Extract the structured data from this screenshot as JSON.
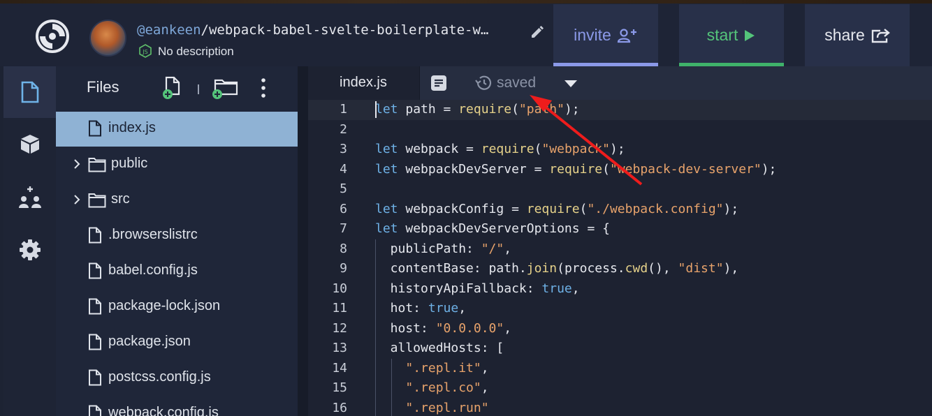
{
  "header": {
    "repo_user": "@eankeen",
    "repo_sep": "/",
    "repo_name": "webpack-babel-svelte-boilerplate-w…",
    "description": "No description",
    "invite_label": "invite",
    "start_label": "start",
    "share_label": "share",
    "colors": {
      "invite": "#8b99e8",
      "start": "#3fb26a"
    }
  },
  "icon_rail": [
    "files-icon",
    "packages-icon",
    "multiplayer-icon",
    "settings-icon"
  ],
  "files": {
    "title": "Files",
    "items": [
      {
        "name": "index.js",
        "type": "file",
        "active": true
      },
      {
        "name": "public",
        "type": "folder"
      },
      {
        "name": "src",
        "type": "folder"
      },
      {
        "name": ".browserslistrc",
        "type": "file"
      },
      {
        "name": "babel.config.js",
        "type": "file"
      },
      {
        "name": "package-lock.json",
        "type": "file"
      },
      {
        "name": "package.json",
        "type": "file"
      },
      {
        "name": "postcss.config.js",
        "type": "file"
      },
      {
        "name": "webpack.config.js",
        "type": "file"
      }
    ]
  },
  "editor": {
    "tab": "index.js",
    "status": "saved",
    "lines": [
      [
        [
          "kw",
          "let"
        ],
        [
          "t",
          " path = "
        ],
        [
          "fn",
          "require"
        ],
        [
          "t",
          "("
        ],
        [
          "str",
          "\"path\""
        ],
        [
          "t",
          ");"
        ]
      ],
      [],
      [
        [
          "kw",
          "let"
        ],
        [
          "t",
          " webpack = "
        ],
        [
          "fn",
          "require"
        ],
        [
          "t",
          "("
        ],
        [
          "str",
          "\"webpack\""
        ],
        [
          "t",
          ");"
        ]
      ],
      [
        [
          "kw",
          "let"
        ],
        [
          "t",
          " webpackDevServer = "
        ],
        [
          "fn",
          "require"
        ],
        [
          "t",
          "("
        ],
        [
          "str",
          "\"webpack-dev-server\""
        ],
        [
          "t",
          ");"
        ]
      ],
      [],
      [
        [
          "kw",
          "let"
        ],
        [
          "t",
          " webpackConfig = "
        ],
        [
          "fn",
          "require"
        ],
        [
          "t",
          "("
        ],
        [
          "str",
          "\"./webpack.config\""
        ],
        [
          "t",
          ");"
        ]
      ],
      [
        [
          "kw",
          "let"
        ],
        [
          "t",
          " webpackDevServerOptions = {"
        ]
      ],
      [
        [
          "t",
          "  publicPath: "
        ],
        [
          "str",
          "\"/\""
        ],
        [
          "t",
          ","
        ]
      ],
      [
        [
          "t",
          "  contentBase: path."
        ],
        [
          "fn",
          "join"
        ],
        [
          "t",
          "(process."
        ],
        [
          "fn",
          "cwd"
        ],
        [
          "t",
          "(), "
        ],
        [
          "str",
          "\"dist\""
        ],
        [
          "t",
          "),"
        ]
      ],
      [
        [
          "t",
          "  historyApiFallback: "
        ],
        [
          "kw",
          "true"
        ],
        [
          "t",
          ","
        ]
      ],
      [
        [
          "t",
          "  hot: "
        ],
        [
          "kw",
          "true"
        ],
        [
          "t",
          ","
        ]
      ],
      [
        [
          "t",
          "  host: "
        ],
        [
          "str",
          "\"0.0.0.0\""
        ],
        [
          "t",
          ","
        ]
      ],
      [
        [
          "t",
          "  allowedHosts: ["
        ]
      ],
      [
        [
          "t",
          "    "
        ],
        [
          "str",
          "\".repl.it\""
        ],
        [
          "t",
          ","
        ]
      ],
      [
        [
          "t",
          "    "
        ],
        [
          "str",
          "\".repl.co\""
        ],
        [
          "t",
          ","
        ]
      ],
      [
        [
          "t",
          "    "
        ],
        [
          "str",
          "\".repl.run\""
        ]
      ]
    ]
  }
}
